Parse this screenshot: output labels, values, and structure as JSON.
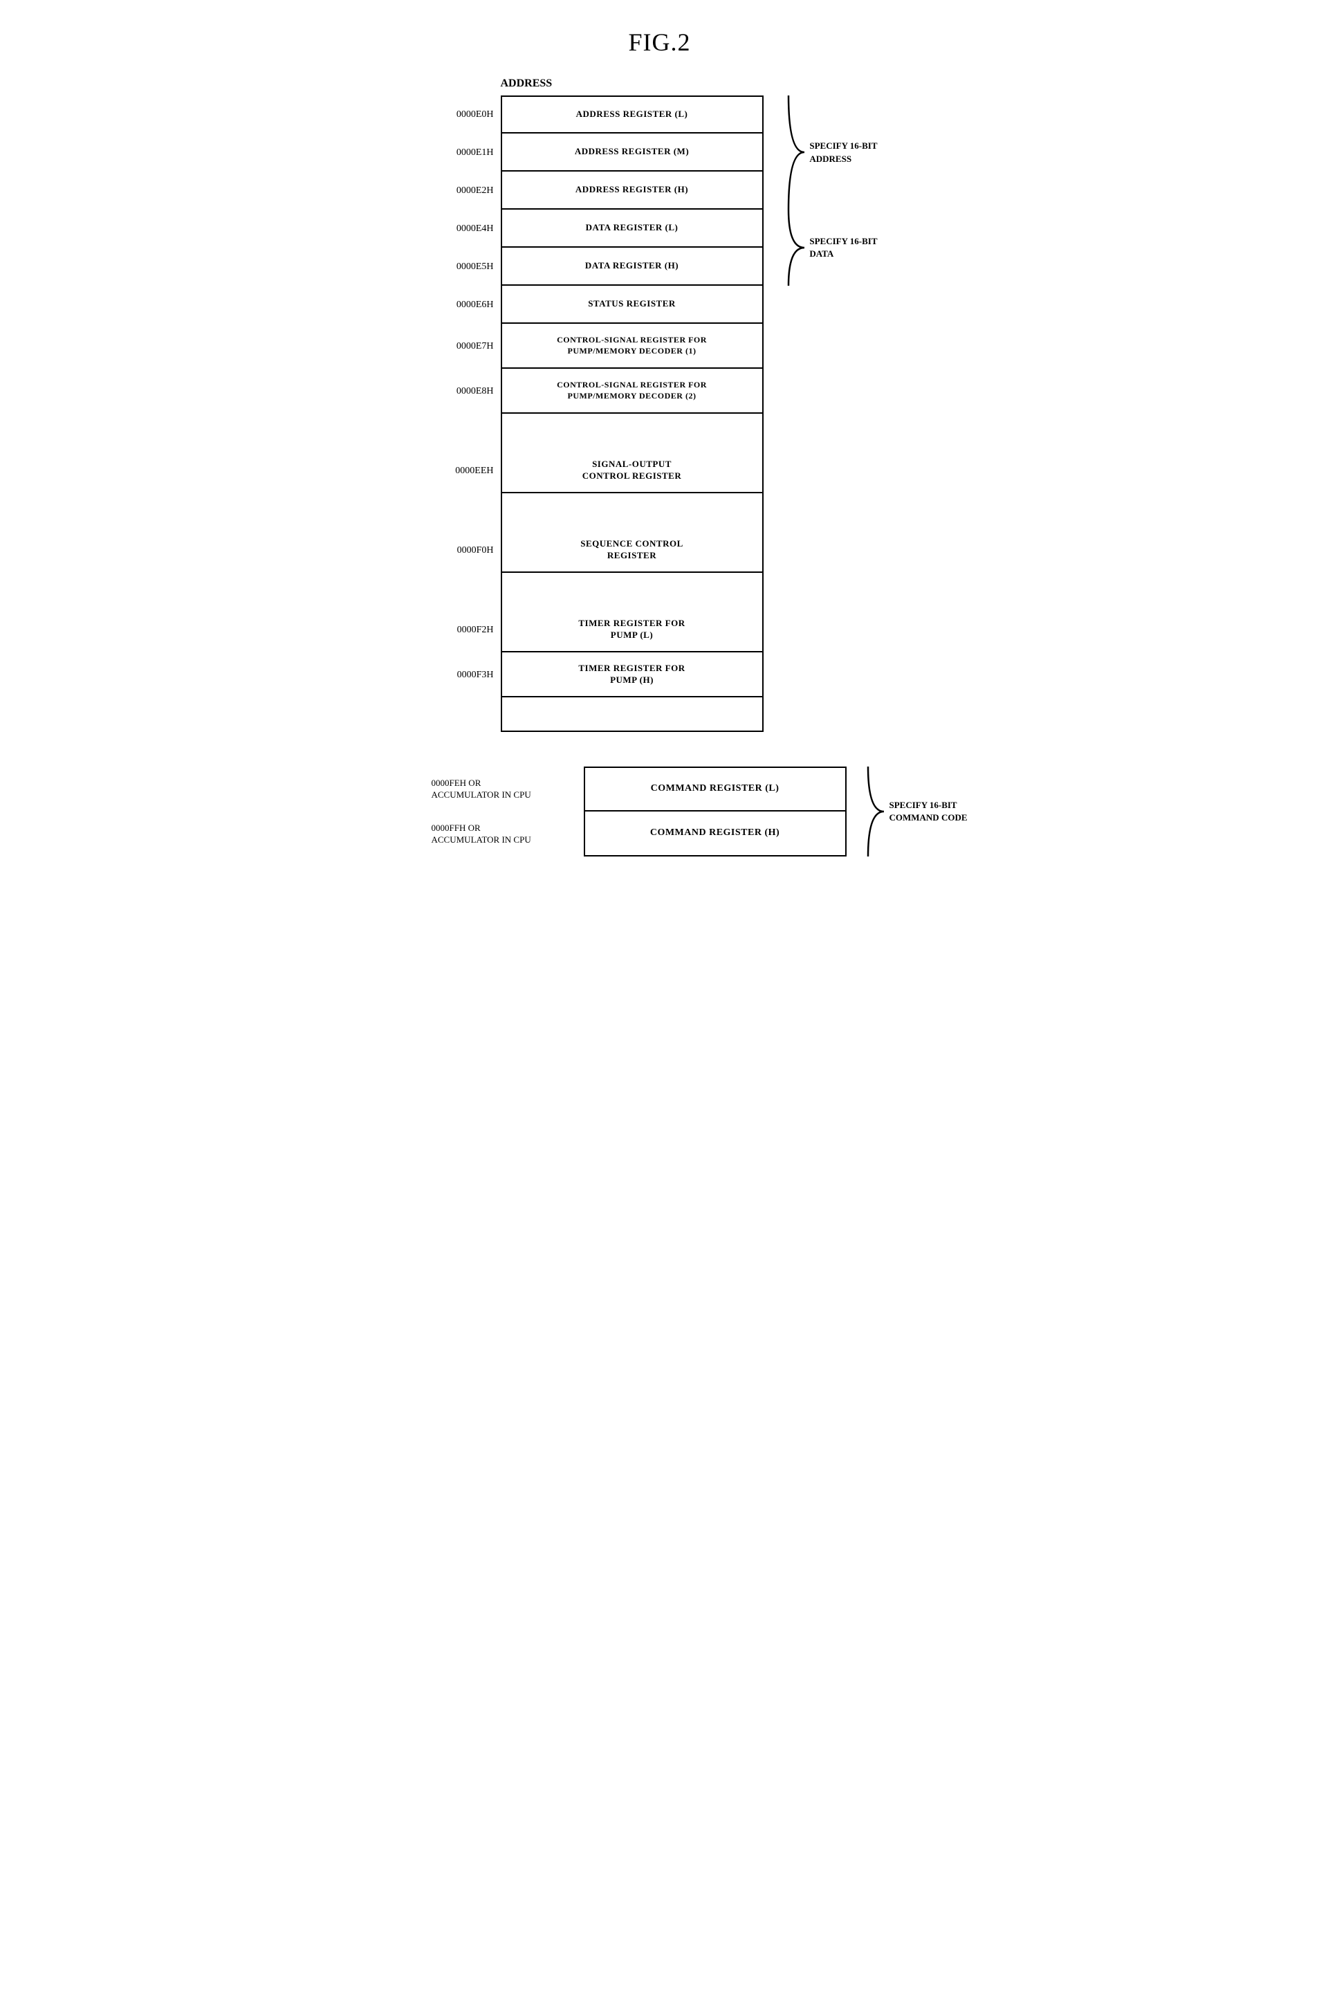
{
  "title": "FIG.2",
  "diagram": {
    "address_label": "ADDRESS",
    "registers": [
      {
        "addr": "0000E0H",
        "label": "ADDRESS REGISTER (L)",
        "type": "normal",
        "first": true
      },
      {
        "addr": "0000E1H",
        "label": "ADDRESS REGISTER (M)",
        "type": "normal"
      },
      {
        "addr": "0000E2H",
        "label": "ADDRESS REGISTER (H)",
        "type": "normal"
      },
      {
        "addr": "0000E4H",
        "label": "DATA REGISTER (L)",
        "type": "normal"
      },
      {
        "addr": "0000E5H",
        "label": "DATA REGISTER (H)",
        "type": "normal"
      },
      {
        "addr": "0000E6H",
        "label": "STATUS REGISTER",
        "type": "normal"
      },
      {
        "addr": "0000E7H",
        "label": "CONTROL-SIGNAL REGISTER FOR\nPUMP/MEMORY DECODER (1)",
        "type": "normal"
      },
      {
        "addr": "0000E8H",
        "label": "CONTROL-SIGNAL REGISTER FOR\nPUMP/MEMORY DECODER (2)",
        "type": "normal"
      },
      {
        "addr": "",
        "label": "",
        "type": "empty"
      },
      {
        "addr": "0000EEH",
        "label": "SIGNAL-OUTPUT\nCONTROL REGISTER",
        "type": "normal"
      },
      {
        "addr": "",
        "label": "",
        "type": "empty"
      },
      {
        "addr": "0000F0H",
        "label": "SEQUENCE CONTROL\nREGISTER",
        "type": "normal"
      },
      {
        "addr": "",
        "label": "",
        "type": "empty"
      },
      {
        "addr": "0000F2H",
        "label": "TIMER REGISTER FOR\nPUMP (L)",
        "type": "normal"
      },
      {
        "addr": "0000F3H",
        "label": "TIMER REGISTER FOR\nPUMP (H)",
        "type": "normal"
      },
      {
        "addr": "",
        "label": "",
        "type": "empty",
        "last": true
      }
    ],
    "brace_groups": [
      {
        "id": "address-brace",
        "text": "SPECIFY 16-BIT\nADDRESS",
        "rows": 3
      },
      {
        "id": "data-brace",
        "text": "SPECIFY 16-BIT\nDATA",
        "rows": 2
      }
    ],
    "bottom_registers": [
      {
        "addr": "0000FEH OR\nACCUMULATOR IN CPU",
        "label": "COMMAND REGISTER (L)",
        "first": true
      },
      {
        "addr": "0000FFH OR\nACCUMULATOR IN CPU",
        "label": "COMMAND REGISTER (H)"
      }
    ],
    "bottom_brace_text": "SPECIFY 16-BIT\nCOMMAND CODE"
  }
}
